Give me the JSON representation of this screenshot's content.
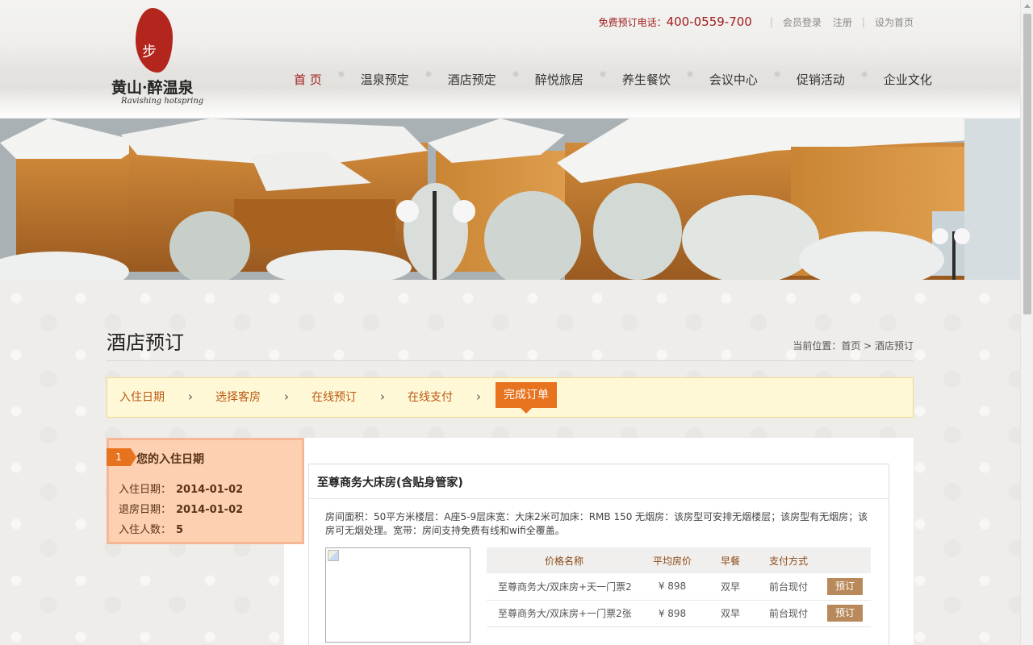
{
  "header": {
    "logo_text": "黄山·醉温泉",
    "logo_sub": "Ravishing hotspring",
    "hotline_label": "免费预订电话：",
    "hotline_number": "400-0559-700",
    "links": [
      "会员登录",
      "注册",
      "设为首页"
    ]
  },
  "nav": {
    "items": [
      "首 页",
      "温泉预定",
      "酒店预定",
      "醉悦旅居",
      "养生餐饮",
      "会议中心",
      "促销活动",
      "企业文化"
    ],
    "active_index": 0
  },
  "page": {
    "title": "酒店预订",
    "breadcrumb": "当前位置：首页 > 酒店预订"
  },
  "steps": {
    "items": [
      "入住日期",
      "选择客房",
      "在线预订",
      "在线支付"
    ],
    "active": "完成订单",
    "arrow": "›"
  },
  "side": {
    "badge": "1",
    "heading": "您的入住日期",
    "checkin_label": "入住日期：",
    "checkin_value": "2014-01-02",
    "checkout_label": "退房日期：",
    "checkout_value": "2014-01-02",
    "guests_label": "入住人数：",
    "guests_value": "5"
  },
  "room": {
    "title": "至尊商务大床房(含贴身管家)",
    "description": "房间面积：50平方米楼层：A座5-9层床宽：大床2米可加床：RMB 150 无烟房：该房型可安排无烟楼层；该房型有无烟房；该房可无烟处理。宽带：房间支持免费有线和wifi全覆盖。",
    "table": {
      "headers": [
        "价格名称",
        "平均房价",
        "早餐",
        "支付方式",
        ""
      ],
      "rows": [
        {
          "name": "至尊商务大/双床房+天一门票2",
          "price": "¥ 898",
          "breakfast": "双早",
          "payment": "前台现付",
          "action": "预订"
        },
        {
          "name": "至尊商务大/双床房+一门票2张",
          "price": "¥ 898",
          "breakfast": "双早",
          "payment": "前台现付",
          "action": "预订"
        }
      ]
    }
  },
  "colors": {
    "brand_red": "#9d1b1b",
    "accent_orange": "#e8731f",
    "step_bg": "#fff8d6",
    "side_bg": "#fcd0b0",
    "book_button": "#b8895a"
  }
}
